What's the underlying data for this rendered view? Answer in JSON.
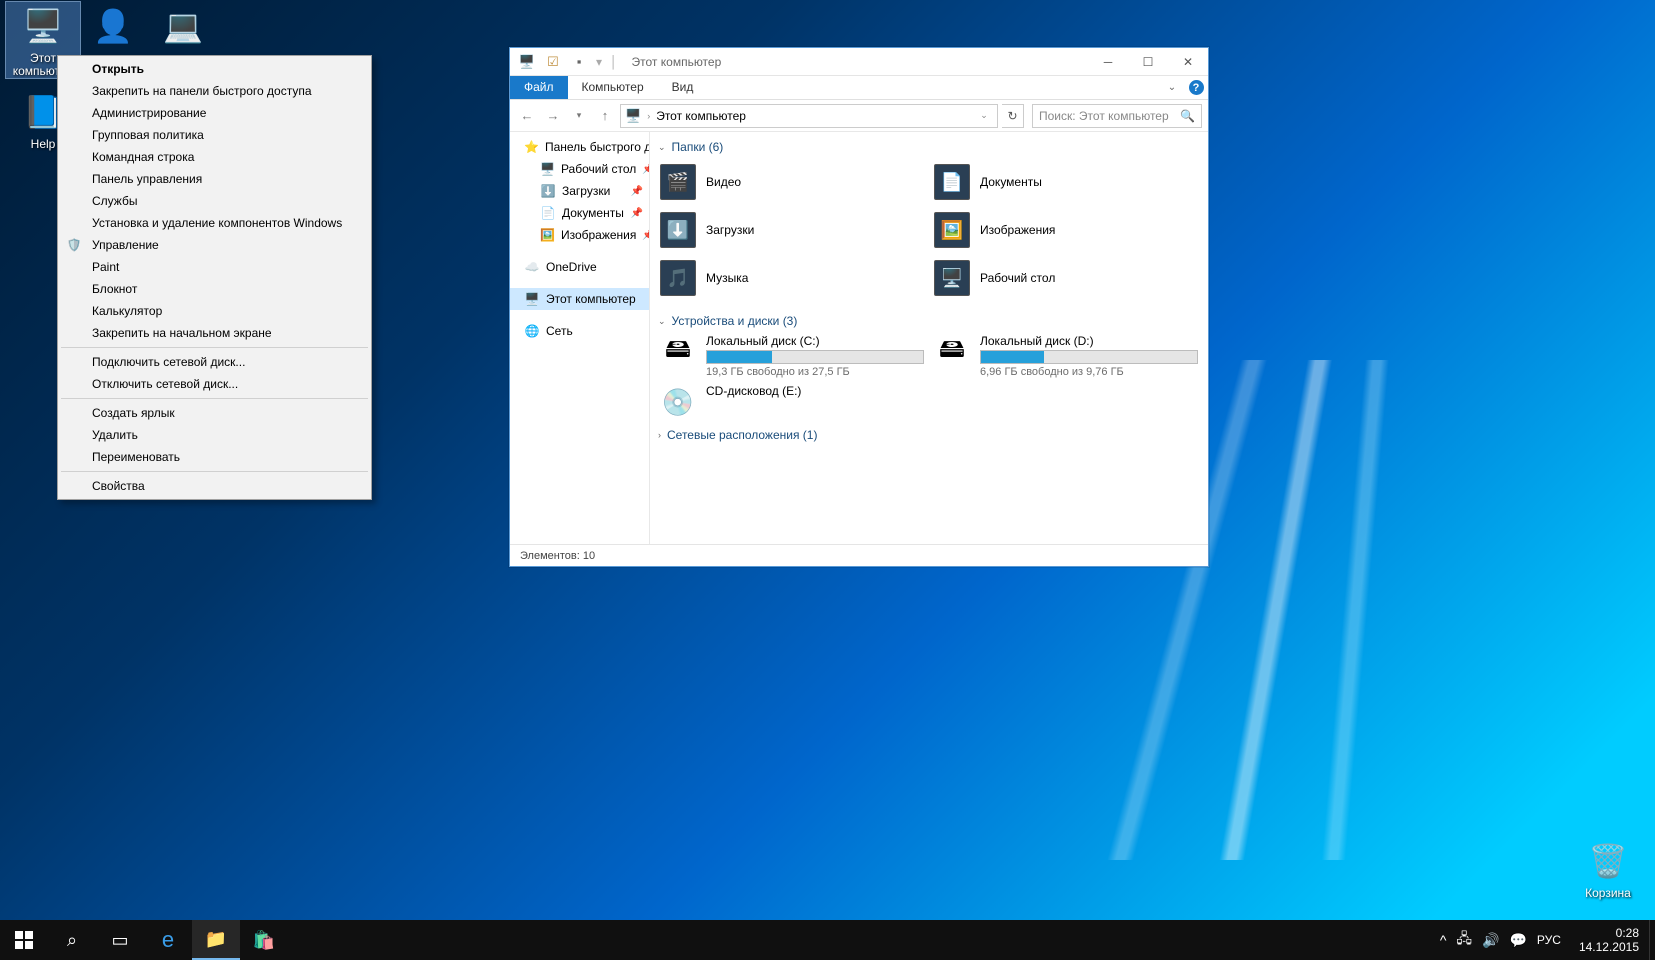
{
  "desktop_icons": {
    "this_pc": "Этот компьютер",
    "help": "Help",
    "recycle_bin": "Корзина"
  },
  "context_menu": {
    "open": "Открыть",
    "pin_quick": "Закрепить на панели быстрого доступа",
    "admin": "Администрирование",
    "group_policy": "Групповая политика",
    "cmd": "Командная строка",
    "control_panel": "Панель управления",
    "services": "Службы",
    "add_remove": "Установка и удаление компонентов Windows",
    "manage": "Управление",
    "paint": "Paint",
    "notepad": "Блокнот",
    "calculator": "Калькулятор",
    "pin_start": "Закрепить на начальном экране",
    "map_drive": "Подключить сетевой диск...",
    "disconnect_drive": "Отключить сетевой диск...",
    "create_shortcut": "Создать ярлык",
    "delete": "Удалить",
    "rename": "Переименовать",
    "properties": "Свойства"
  },
  "explorer": {
    "title": "Этот компьютер",
    "tabs": {
      "file": "Файл",
      "computer": "Компьютер",
      "view": "Вид"
    },
    "breadcrumb": "Этот компьютер",
    "search_placeholder": "Поиск: Этот компьютер",
    "navpane": {
      "quick_access": "Панель быстрого до",
      "desktop": "Рабочий стол",
      "downloads": "Загрузки",
      "documents": "Документы",
      "pictures": "Изображения",
      "onedrive": "OneDrive",
      "this_pc": "Этот компьютер",
      "network": "Сеть"
    },
    "groups": {
      "folders": "Папки (6)",
      "devices": "Устройства и диски (3)",
      "network": "Сетевые расположения (1)"
    },
    "folders": {
      "video": "Видео",
      "documents": "Документы",
      "downloads": "Загрузки",
      "pictures": "Изображения",
      "music": "Музыка",
      "desktop": "Рабочий стол"
    },
    "drives": {
      "c": {
        "name": "Локальный диск (C:)",
        "free": "19,3 ГБ свободно из 27,5 ГБ",
        "fill_pct": 30
      },
      "d": {
        "name": "Локальный диск (D:)",
        "free": "6,96 ГБ свободно из 9,76 ГБ",
        "fill_pct": 29
      },
      "e": {
        "name": "CD-дисковод (E:)"
      }
    },
    "status": "Элементов: 10"
  },
  "taskbar": {
    "lang": "РУС",
    "time": "0:28",
    "date": "14.12.2015"
  }
}
